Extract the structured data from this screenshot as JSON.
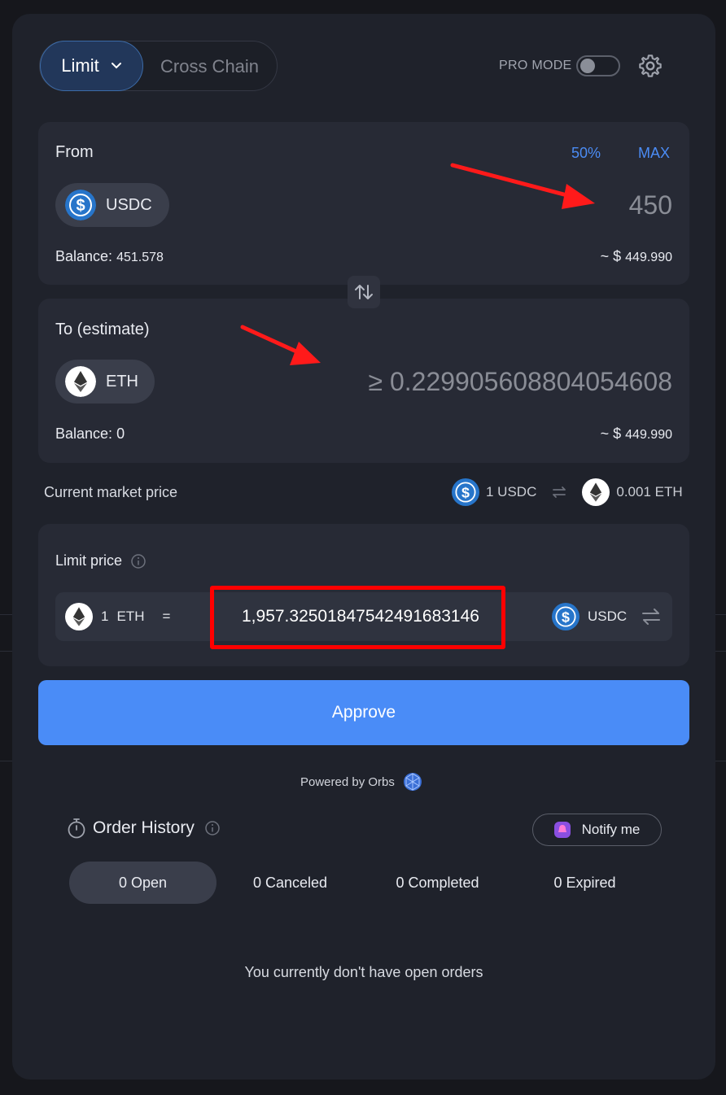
{
  "colors": {
    "accent": "#4a8cf7",
    "background": "#1f222b",
    "card": "#272a35",
    "annotation": "#ff0000"
  },
  "header": {
    "mode_selected": "Limit",
    "mode_other": "Cross Chain",
    "pro_mode_label": "PRO MODE",
    "pro_mode_enabled": false
  },
  "from": {
    "label": "From",
    "pct_50": "50%",
    "max": "MAX",
    "token": "USDC",
    "amount": "450",
    "balance_label": "Balance:",
    "balance_value": "451.578",
    "usd_prefix": "~ $",
    "usd_value": "449.990"
  },
  "to": {
    "label": "To (estimate)",
    "token": "ETH",
    "amount": "≥ 0.229905608804054608",
    "balance_label": "Balance:",
    "balance_value": "0",
    "usd_prefix": "~ $",
    "usd_value": "449.990"
  },
  "market": {
    "label": "Current market price",
    "left": "1 USDC",
    "right": "0.001 ETH"
  },
  "limit": {
    "label": "Limit price",
    "base_amount": "1",
    "base_token": "ETH",
    "equals": "=",
    "price": "1,957.3250184754249168 3146",
    "quote_token": "USDC"
  },
  "approve_label": "Approve",
  "powered_by": "Powered by Orbs",
  "history": {
    "title": "Order History",
    "notify": "Notify me",
    "tabs": [
      "0 Open",
      "0 Canceled",
      "0 Completed",
      "0 Expired"
    ],
    "empty": "You currently don't have open orders"
  }
}
